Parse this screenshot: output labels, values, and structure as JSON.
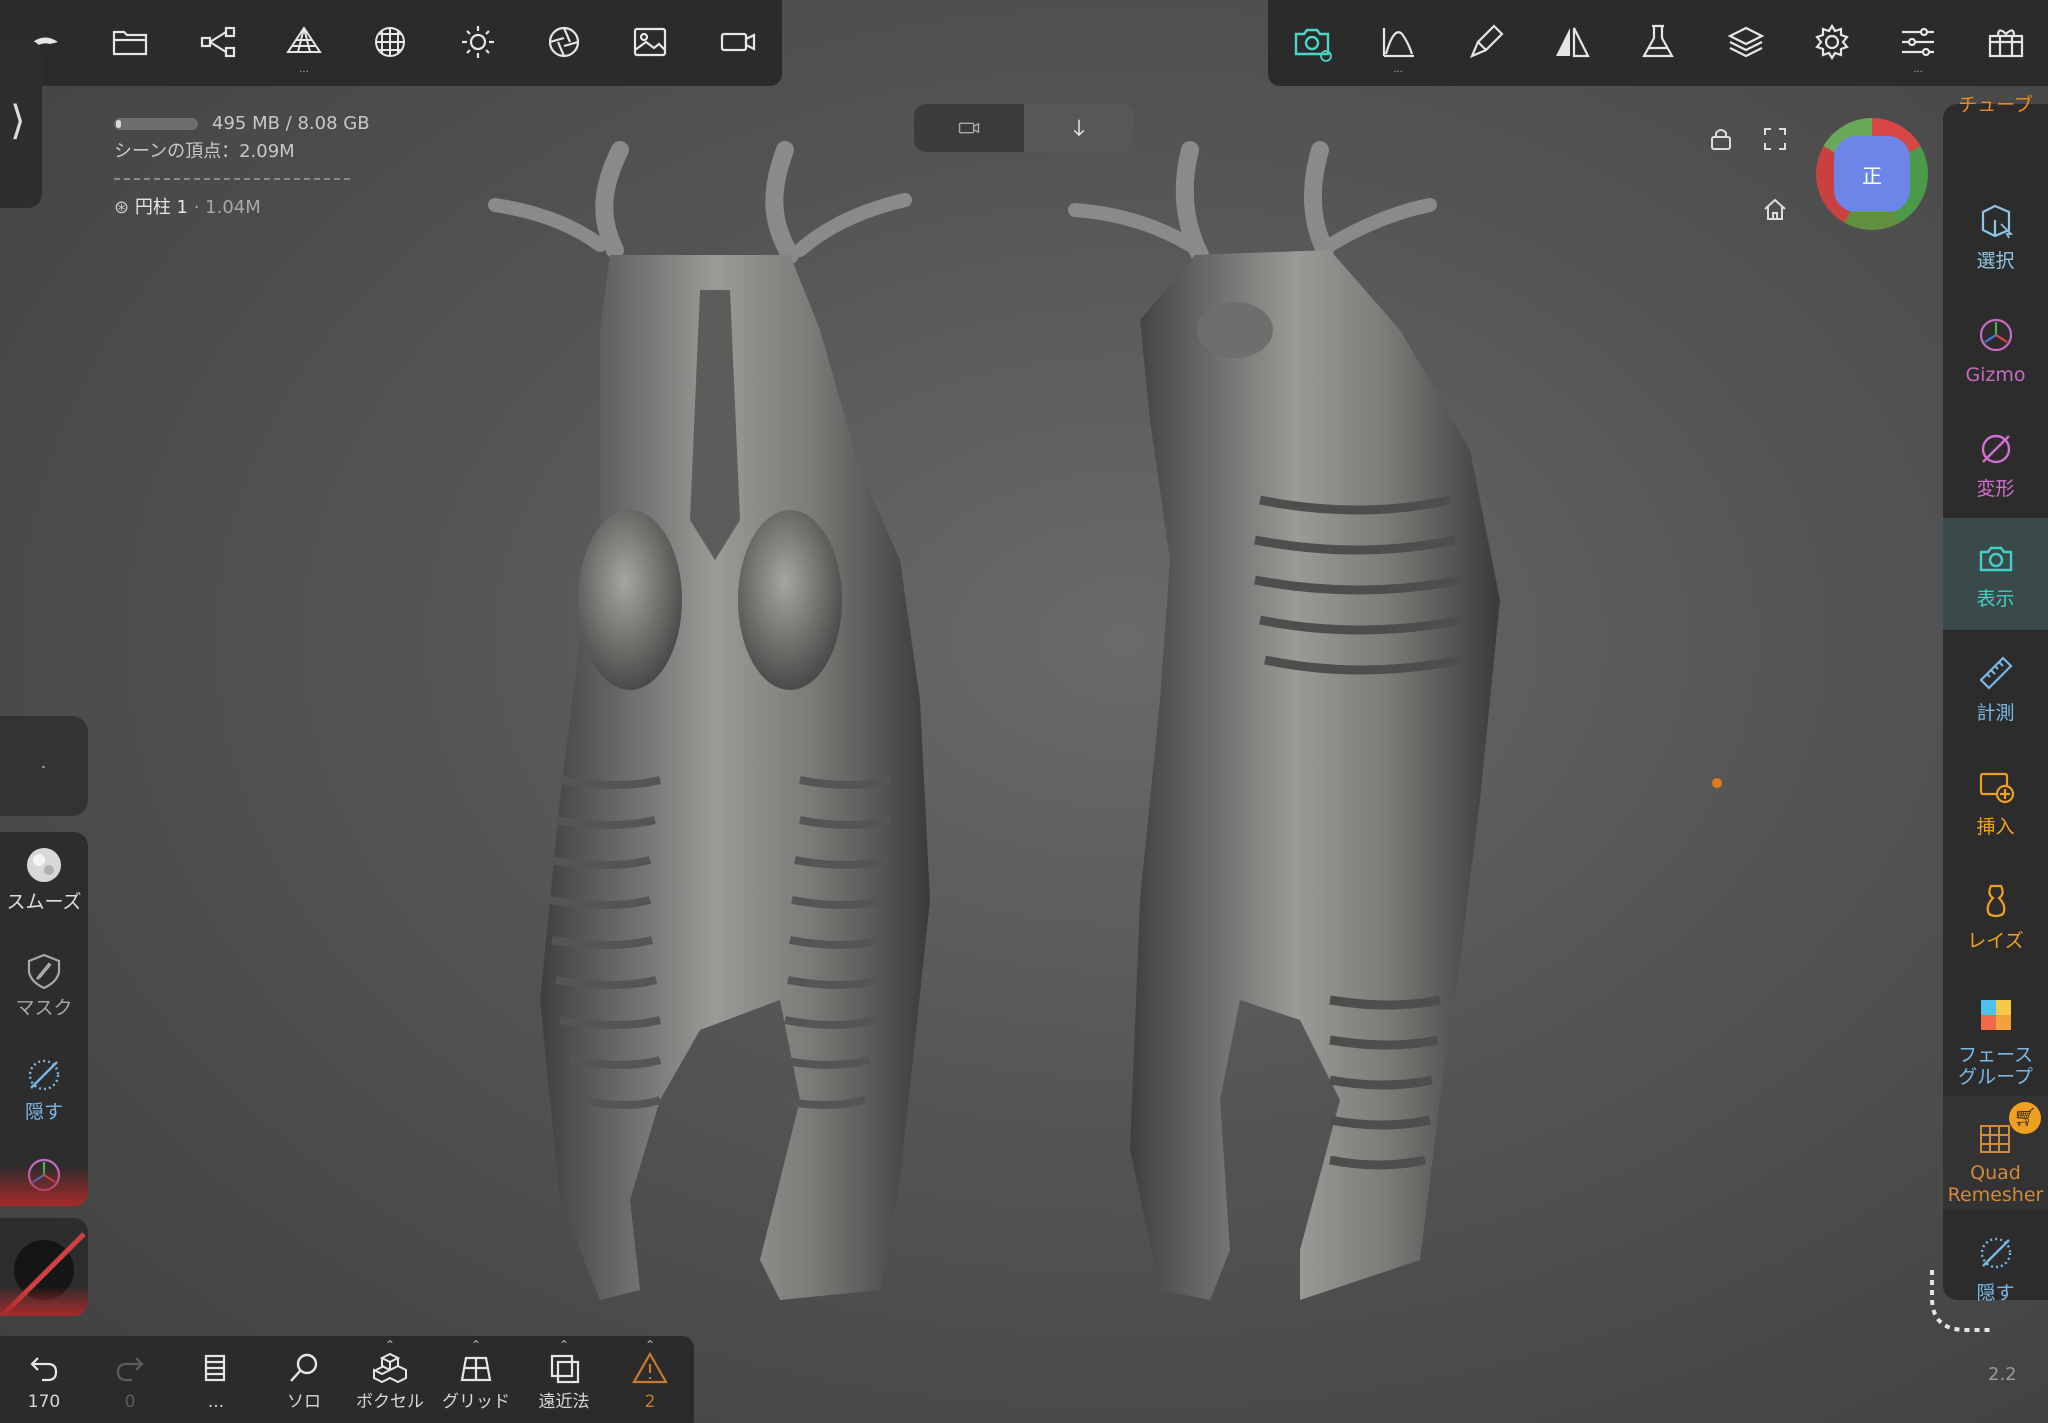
{
  "top_toolbar_left": {
    "icons": [
      "back-arrow-icon",
      "folder-icon",
      "share-icon",
      "topology-icon",
      "sphere-grid-icon",
      "sun-icon",
      "aperture-icon",
      "image-icon",
      "video-icon"
    ]
  },
  "top_toolbar_right": {
    "icons": [
      "camera-icon",
      "curve-icon",
      "brush-icon",
      "symmetry-icon",
      "flask-icon",
      "layers-icon",
      "gear-icon",
      "sliders-icon",
      "gift-icon"
    ]
  },
  "stats": {
    "memory": "495 MB / 8.08 GB",
    "scene_vertices": "シーンの頂点：2.09M",
    "object_name": "円柱 1",
    "object_vertices": " · 1.04M"
  },
  "camera_toggle": {
    "icons": [
      "video-icon",
      "down-arrow-icon"
    ],
    "active_index": 1
  },
  "view_cube": {
    "face_label": "正"
  },
  "right_sidebar": {
    "items": [
      {
        "label": "チューブ",
        "color": "#f08a1c",
        "icon": "tube-icon"
      },
      {
        "label": "選択",
        "color": "#8ec6e6",
        "icon": "select-icon"
      },
      {
        "label": "Gizmo",
        "color": "#c86bc0",
        "icon": "gizmo-icon"
      },
      {
        "label": "変形",
        "color": "#d36fd0",
        "icon": "transform-icon"
      },
      {
        "label": "表示",
        "color": "#3fd0c8",
        "icon": "view-camera-icon"
      },
      {
        "label": "計測",
        "color": "#79b8e6",
        "icon": "ruler-icon"
      },
      {
        "label": "挿入",
        "color": "#f0a020",
        "icon": "insert-icon"
      },
      {
        "label": "レイズ",
        "color": "#f0a020",
        "icon": "lathe-icon"
      },
      {
        "label": "フェースグループ",
        "color": "#79b8e6",
        "icon": "facegroup-icon"
      },
      {
        "label": "Quad Remesher",
        "color": "#d08a3a",
        "icon": "quad-remesher-icon"
      },
      {
        "label": "隠す",
        "color": "#79b8e6",
        "icon": "hide-icon"
      }
    ],
    "active_index": 4
  },
  "left_sidebar": {
    "items": [
      {
        "label": "スムーズ",
        "icon": "smooth-icon",
        "color": "#e0e0e0"
      },
      {
        "label": "マスク",
        "icon": "mask-icon",
        "color": "#a8a8a8"
      },
      {
        "label": "隠す",
        "icon": "hide-icon",
        "color": "#79b8e6"
      }
    ]
  },
  "bottom_toolbar": {
    "items": [
      {
        "label": "170",
        "icon": "undo-icon"
      },
      {
        "label": "0",
        "icon": "redo-icon"
      },
      {
        "label": "...",
        "icon": "book-icon"
      },
      {
        "label": "ソロ",
        "icon": "search-icon"
      },
      {
        "label": "ボクセル",
        "icon": "voxel-icon"
      },
      {
        "label": "グリッド",
        "icon": "grid-icon"
      },
      {
        "label": "遠近法",
        "icon": "perspective-icon"
      },
      {
        "label": "2",
        "icon": "warning-icon"
      }
    ]
  },
  "version": "2.2"
}
